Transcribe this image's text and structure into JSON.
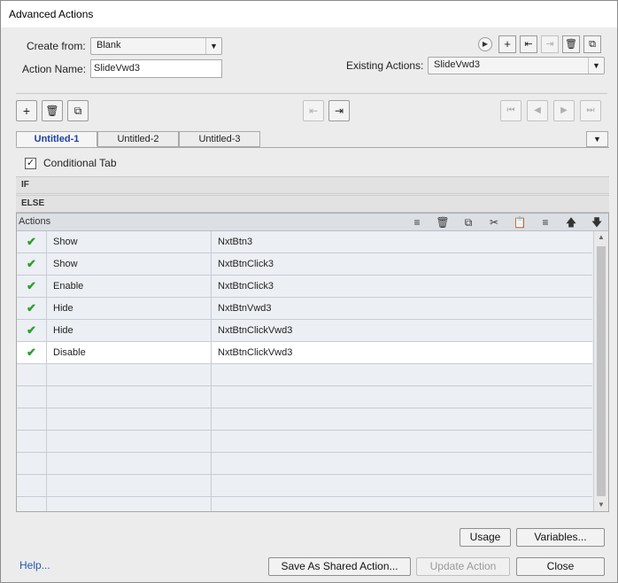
{
  "window": {
    "title": "Advanced Actions"
  },
  "form": {
    "create_from_label": "Create from:",
    "create_from_value": "Blank",
    "action_name_label": "Action Name:",
    "action_name_value": "SlideVwd3",
    "existing_actions_label": "Existing Actions:",
    "existing_actions_value": "SlideVwd3"
  },
  "top_toolbar_icons": [
    "preview-icon",
    "add-icon",
    "import-icon",
    "export-icon",
    "delete-icon",
    "duplicate-icon"
  ],
  "tabs": [
    {
      "label": "Untitled-1",
      "active": true
    },
    {
      "label": "Untitled-2",
      "active": false
    },
    {
      "label": "Untitled-3",
      "active": false
    }
  ],
  "conditional": {
    "label": "Conditional Tab",
    "checked": true,
    "check_glyph": "✓"
  },
  "sections": {
    "if_label": "IF",
    "else_label": "ELSE"
  },
  "actions_grid": {
    "header": "Actions",
    "rows": [
      {
        "status": "✔",
        "action": "Show",
        "target": "NxtBtn3",
        "selected": false
      },
      {
        "status": "✔",
        "action": "Show",
        "target": "NxtBtnClick3",
        "selected": false
      },
      {
        "status": "✔",
        "action": "Enable",
        "target": "NxtBtnClick3",
        "selected": false
      },
      {
        "status": "✔",
        "action": "Hide",
        "target": "NxtBtnVwd3",
        "selected": false
      },
      {
        "status": "✔",
        "action": "Hide",
        "target": "NxtBtnClickVwd3",
        "selected": false
      },
      {
        "status": "✔",
        "action": "Disable",
        "target": "NxtBtnClickVwd3",
        "selected": true
      }
    ],
    "empty_rows": 7
  },
  "buttons": {
    "usage": "Usage",
    "variables": "Variables...",
    "save_shared": "Save As Shared Action...",
    "update_action": "Update Action",
    "close": "Close",
    "help": "Help..."
  },
  "glyphs": {
    "caret": "▼",
    "add": "+",
    "delete": "🗑",
    "copy": "⧉",
    "play": "▶",
    "first": "⏮",
    "prev": "◀",
    "next": "▶",
    "last": "⏭",
    "scroll_up": "▲",
    "scroll_down": "▼",
    "move_up": "🡅",
    "move_down": "🡇",
    "cut": "✂",
    "paste": "📋",
    "insert_above": "≡",
    "insert_below": "≡",
    "dup_row": "⧉",
    "import_tab": "⇤",
    "export_tab": "⇥"
  },
  "colors": {
    "active_tab_text": "#1b3fa6",
    "check_green": "#2aa02a",
    "help_link": "#1f5bb3"
  }
}
